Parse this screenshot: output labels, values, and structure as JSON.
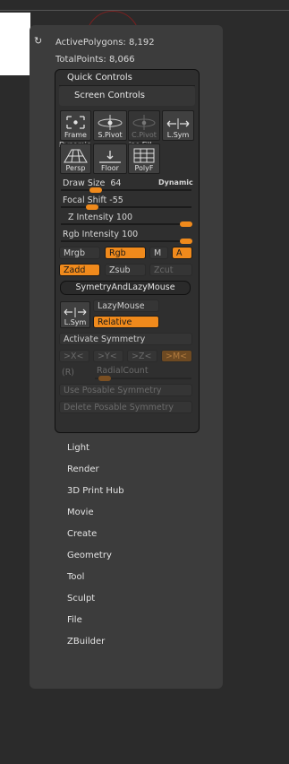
{
  "stats": {
    "active_polygons": "ActivePolygons: 8,192",
    "total_points": "TotalPoints: 8,066"
  },
  "quick_controls": {
    "title": "Quick Controls",
    "screen_controls_title": "Screen Controls",
    "buttons_row1": [
      "Frame",
      "S.Pivot",
      "C.Pivot",
      "L.Sym"
    ],
    "overlay_text": "Dynamic",
    "overlay_text2": "ine Fill",
    "buttons_row2": [
      "Persp",
      "Floor",
      "PolyF"
    ],
    "draw_size": {
      "label": "Draw Size",
      "value": "64",
      "dynamic": "Dynamic"
    },
    "focal_shift": {
      "label": "Focal Shift",
      "value": "-55"
    },
    "z_intensity": {
      "label": "Z Intensity",
      "value": "100"
    },
    "rgb_intensity": {
      "label": "Rgb Intensity",
      "value": "100"
    },
    "color_row": [
      "Mrgb",
      "Rgb",
      "M",
      "A"
    ],
    "z_row": [
      "Zadd",
      "Zsub",
      "Zcut"
    ],
    "symmetry_lazy": "SymetryAndLazyMouse",
    "lsym": "L.Sym",
    "lazymouse": "LazyMouse",
    "relative": "Relative",
    "activate_symmetry": "Activate Symmetry",
    "axis_buttons": [
      ">X<",
      ">Y<",
      ">Z<",
      ">M<"
    ],
    "r_label": "(R)",
    "radial_count": "RadialCount",
    "use_posable": "Use Posable Symmetry",
    "delete_posable": "Delete Posable Symmetry"
  },
  "menu_items": [
    "Light",
    "Render",
    "3D Print Hub",
    "Movie",
    "Create",
    "Geometry",
    "Tool",
    "Sculpt",
    "File",
    "ZBuilder"
  ],
  "colors": {
    "accent": "#f08a1c",
    "panel": "#3c3c3c",
    "background": "#2b2b2b"
  }
}
